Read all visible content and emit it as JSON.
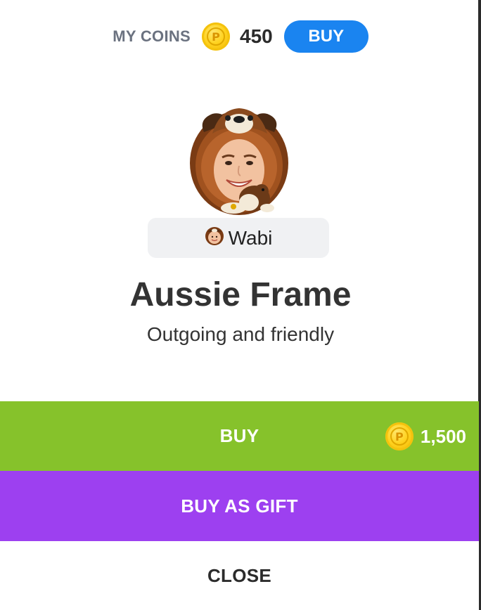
{
  "wallet": {
    "label": "MY COINS",
    "coin_icon": "coin-icon",
    "balance": "450",
    "buy_label": "BUY"
  },
  "item": {
    "avatar_icon": "dog-frame-avatar-icon",
    "owner_icon": "dog-frame-mini-icon",
    "owner_name": "Wabi",
    "title": "Aussie Frame",
    "subtitle": "Outgoing and friendly"
  },
  "actions": {
    "buy_label": "BUY",
    "price": "1,500",
    "gift_label": "BUY AS GIFT",
    "close_label": "CLOSE"
  },
  "colors": {
    "buy_green": "#86c22b",
    "gift_purple": "#9d40f0",
    "pill_blue": "#1a84f0",
    "coin_gold": "#ffd21f"
  }
}
